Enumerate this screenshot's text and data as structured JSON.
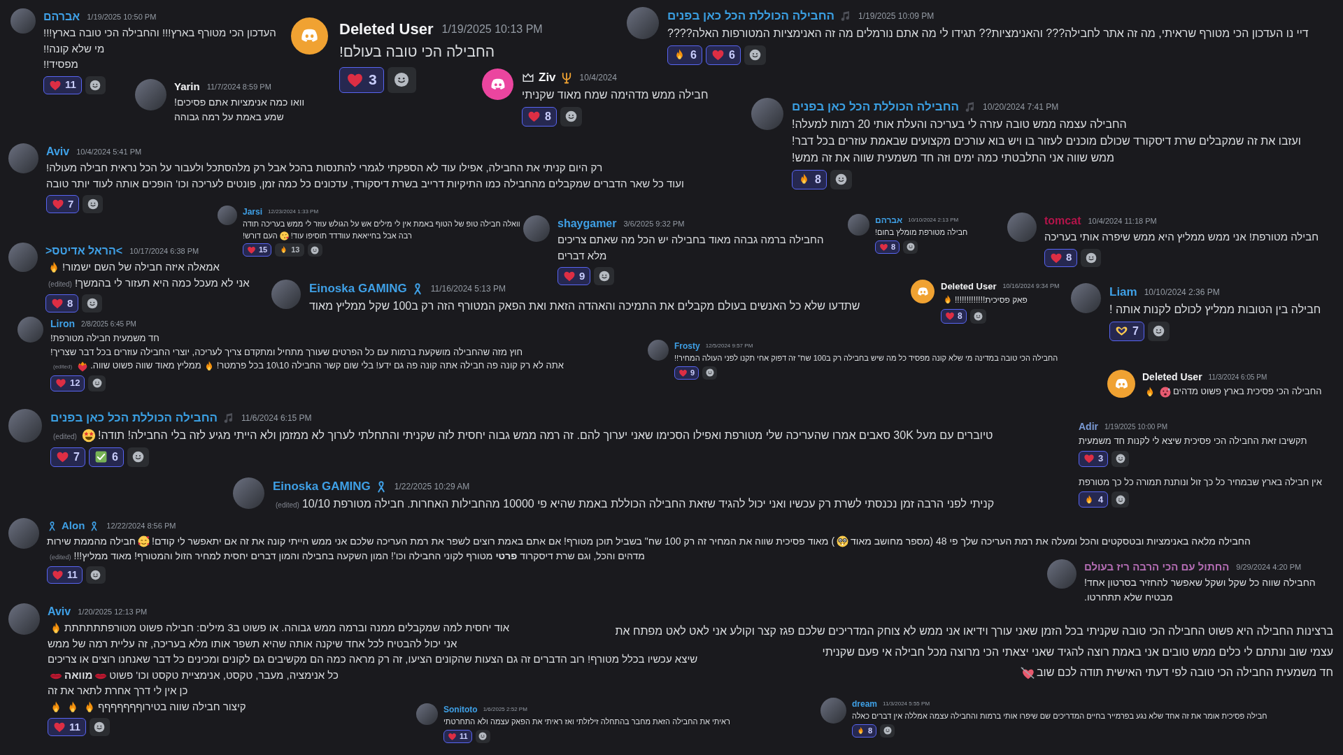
{
  "messages": [
    {
      "name": "החבילה הכוללת הכל כאן בפנים",
      "color": "#3a9ee0",
      "badges_after": [
        {
          "kind": "note"
        }
      ],
      "time": "1/19/2025 10:09 PM",
      "avatar": {
        "kind": "picture"
      },
      "lines": [
        "דיי נו העדכון הכי מטורף שראיתי, מה זה אתר לחבילה??? והאנימציות?? תגידו לי מה אתם נורמלים מה זה האנימציות המטורפות האלה????"
      ],
      "reactions": [
        {
          "kind": "heart",
          "count": "6",
          "selected": true
        },
        {
          "kind": "fire",
          "count": "6",
          "selected": true
        }
      ]
    },
    {
      "name": "Deleted User",
      "color": "#f2f3f5",
      "time": "1/19/2025 10:13 PM",
      "avatar": {
        "kind": "discord",
        "color": "#f0a232"
      },
      "lines": [
        "החבילה הכי טובה בעולם!"
      ],
      "reactions": [
        {
          "kind": "heart",
          "count": "3",
          "selected": true
        }
      ]
    },
    {
      "name": "אברהם",
      "color": "#3fa0e6",
      "time": "1/19/2025 10:50 PM",
      "avatar": {
        "kind": "picture"
      },
      "lines": [
        "העדכון הכי מטורף בארץ!!! והחבילה הכי טובה בארץ!!!",
        "מי שלא קונה!!",
        "מפסיד!!"
      ],
      "reactions": [
        {
          "kind": "heart",
          "count": "11",
          "selected": true
        }
      ]
    },
    {
      "name": "החבילה הכוללת הכל כאן בפנים",
      "color": "#3a9ee0",
      "badges_after": [
        {
          "kind": "note"
        }
      ],
      "time": "10/20/2024 7:41 PM",
      "avatar": {
        "kind": "picture"
      },
      "lines": [
        "החבילה עצמה ממש טובה עזרה לי בעריכה והעלת אותי 20 רמות למעלה!",
        "ועזבו את זה שמקבלים שרת דיסקורד שכולם מוכנים לעזור בו ויש בוא עורכים מקצועים שבאמת עוזרים בכל דבר!",
        "ממש שווה אני התלבטתי כמה ימים וזה חד משמעית שווה את זה ממש!"
      ],
      "reactions": [
        {
          "kind": "fire",
          "count": "8",
          "selected": true
        }
      ]
    },
    {
      "name": "Ziv",
      "color": "#f2f3f5",
      "badges_before": [
        {
          "kind": "crown"
        }
      ],
      "badges_after": [
        {
          "kind": "trident"
        }
      ],
      "time": "10/4/2024",
      "avatar": {
        "kind": "discord",
        "color": "#eb459f"
      },
      "lines": [
        "חבילה ממש מדהימה שמח מאוד שקניתי"
      ],
      "reactions": [
        {
          "kind": "heart",
          "count": "8",
          "selected": true
        }
      ]
    },
    {
      "name": "Yarin",
      "color": "#f2f3f5",
      "time": "11/7/2024 8:59 PM",
      "avatar": {
        "kind": "picture"
      },
      "lines": [
        "וואו כמה אנימציות אתם פסיכים!",
        "שמע באמת על רמה גבוהה"
      ]
    },
    {
      "name": "Aviv",
      "color": "#3fa0e6",
      "time": "10/4/2024 5:41 PM",
      "avatar": {
        "kind": "picture"
      },
      "lines": [
        "רק היום קניתי את החבילה, אפילו עוד לא הספקתי לגמרי להתנסות בהכל אבל רק מלהסתכל ולעבור על הכל נראית חבילה מעולה!",
        "ועוד כל שאר הדברים שמקבלים מהחבילה כמו התיקיות דרייב בשרת דיסקורד, עדכונים כל כמה זמן, פונטים לעריכה וכו' הופכים אותה לעוד יותר טובה"
      ],
      "reactions": [
        {
          "kind": "heart",
          "count": "7",
          "selected": true
        }
      ]
    },
    {
      "name": "tomcat",
      "color": "#b3144a",
      "time": "10/4/2024 11:18 PM",
      "avatar": {
        "kind": "picture"
      },
      "lines": [
        "חבילה מטורפת! אני ממש ממליץ היא ממש שיפרה אותי בעריכה"
      ],
      "reactions": [
        {
          "kind": "heart",
          "count": "8",
          "selected": true
        }
      ]
    },
    {
      "name": "אברהם",
      "color": "#3fa0e6",
      "time": "10/10/2024 2:13 PM",
      "avatar": {
        "kind": "picture"
      },
      "lines": [
        "חבילה מטורפת מומלץ בחום!"
      ],
      "reactions": [
        {
          "kind": "heart",
          "count": "8",
          "selected": true
        }
      ]
    },
    {
      "name": "shaygamer",
      "color": "#3fa0e6",
      "time": "3/6/2025 9:32 PM",
      "avatar": {
        "kind": "picture"
      },
      "lines": [
        "החבילה ברמה גבהה מאוד בחבילה יש הכל מה שאתם צריכים",
        "מלא דברים"
      ],
      "reactions": [
        {
          "kind": "heart",
          "count": "9",
          "selected": true
        }
      ]
    },
    {
      "name": "Jarsi",
      "color": "#3fa0e6",
      "time": "12/23/2024 1:33 PM",
      "avatar": {
        "kind": "picture"
      },
      "lines": [
        "וואלה חבילה טופ של הטוף באמת אין לי מילים אש על הגולש עוזר לי ממש בעריכה תודה",
        [
          {
            "kind": "text",
            "text": "רבה אבל בחייאאת עוודדד תוסיפו עוד!"
          },
          {
            "kind": "kiss-face"
          },
          {
            "kind": "text",
            "text": "העם דורש!"
          }
        ]
      ],
      "reactions": [
        {
          "kind": "fire",
          "count": "13",
          "selected": false
        },
        {
          "kind": "heart",
          "count": "15",
          "selected": true
        }
      ]
    },
    {
      "name": ">הראל אדיטס<",
      "color": "#3fa0e6",
      "time": "10/17/2024 6:38 PM",
      "avatar": {
        "kind": "picture"
      },
      "lines": [
        [
          {
            "kind": "text",
            "text": "אמאלה איזה חבילה של השם ישמור!"
          },
          {
            "kind": "fire"
          }
        ],
        [
          {
            "kind": "text",
            "text": "אני לא מעכל כמה היא תעזור לי בהמשך!"
          },
          {
            "kind": "edited",
            "text": "(edited)"
          }
        ]
      ],
      "reactions": [
        {
          "kind": "heart",
          "count": "8",
          "selected": true
        }
      ]
    },
    {
      "name": "Liam",
      "color": "#3fa0e6",
      "time": "10/10/2024 2:36 PM",
      "avatar": {
        "kind": "picture"
      },
      "lines": [
        "חבילה בין הטובות ממליץ לכולם לקנות אותה !"
      ],
      "reactions": [
        {
          "kind": "heart-hands",
          "count": "7",
          "selected": true
        }
      ]
    },
    {
      "name": "Deleted User",
      "color": "#f2f3f5",
      "time": "10/16/2024 9:34 PM",
      "avatar": {
        "kind": "discord",
        "color": "#f0a232"
      },
      "lines": [
        [
          {
            "kind": "text",
            "text": "פאק פסיכית!!!!!!!!!!!!!"
          },
          {
            "kind": "fire"
          }
        ]
      ],
      "reactions": [
        {
          "kind": "heart",
          "count": "8",
          "selected": true
        }
      ]
    },
    {
      "name": "Einoska GAMING",
      "color": "#3fa0e6",
      "badges_after": [
        {
          "kind": "ribbon"
        }
      ],
      "time": "11/16/2024 5:13 PM",
      "avatar": {
        "kind": "picture"
      },
      "lines": [
        "שתדעו שלא כל האנשים בעולם מקבלים את התמיכה והאהדה הזאת ואת הפאק המטורף הזה רק ב100 שקל ממליץ מאוד"
      ]
    },
    {
      "name": "Deleted User",
      "color": "#f2f3f5",
      "time": "11/3/2024 6:05 PM",
      "avatar": {
        "kind": "discord",
        "color": "#f0a232"
      },
      "lines": [
        [
          {
            "kind": "text",
            "text": "החבילה הכי פסיכית בארץ פשוט מדהים"
          },
          {
            "kind": "hot-face"
          },
          {
            "kind": "fire"
          }
        ]
      ]
    },
    {
      "name": "Frosty",
      "color": "#3fa0e6",
      "time": "12/5/2024 9:57 PM",
      "avatar": {
        "kind": "picture"
      },
      "lines": [
        "החבילה הכי טובה במדינה מי שלא קונה מפסיד כל מה שיש בחבילה רק ב100 שח\" זה דפוק אחי תקנו לפני העולה המחיר!!"
      ],
      "reactions": [
        {
          "kind": "heart",
          "count": "9",
          "selected": true
        }
      ]
    },
    {
      "name": "Liron",
      "color": "#3fa0e6",
      "time": "2/8/2025 6:45 PM",
      "avatar": {
        "kind": "picture"
      },
      "lines": [
        "חד משמעית חבילה מטורפת!",
        "חוץ מזה שהחבילה מושקעת ברמות עם כל הפרטים שעורך מתחיל ומתקדם צריך לעריכה, יוצרי החבילה עוזרים בכל דבר שצריך!",
        [
          {
            "kind": "text",
            "text": "אתה לא רק קונה פה חבילה אתה קונה פה גם ידע! בלי שום קשר החבילה 10\\10 בכל פרמטר!"
          },
          {
            "kind": "fire"
          },
          {
            "kind": "text",
            "text": "ממליץ מאוד שווה פשוט שווה."
          },
          {
            "kind": "heart-fire"
          },
          {
            "kind": "edited",
            "text": "(edited)"
          }
        ]
      ],
      "reactions": [
        {
          "kind": "heart",
          "count": "12",
          "selected": true
        }
      ]
    },
    {
      "name": "Adir",
      "color": "#7b9bd6",
      "time": "1/19/2025 10:00 PM",
      "lines": [
        "תקשיבו זאת החבילה הכי פסיכית שיצא לי לקנות חד משמעית"
      ],
      "reactions": [
        {
          "kind": "heart",
          "count": "3",
          "selected": true
        }
      ],
      "followups": [
        {
          "lines": [
            "אין חבילה בארץ שבמחיר כל כך זול ונותנת תמורה כל כך מטורפת"
          ],
          "reactions": [
            {
              "kind": "fire",
              "count": "4",
              "selected": true
            }
          ]
        }
      ]
    },
    {
      "name": "החבילה הכוללת הכל כאן בפנים",
      "color": "#3a9ee0",
      "badges_after": [
        {
          "kind": "note"
        }
      ],
      "time": "11/6/2024 6:15 PM",
      "avatar": {
        "kind": "picture"
      },
      "lines": [
        [
          {
            "kind": "text",
            "text": "טיוברים עם מעל 30K סאבים אמרו שהעריכה שלי מטורפת ואפילו הסכימו שאני יערוך להם. זה רמה ממש גבוה יחסית לזה שקניתי והתחלתי לערוך לא ממזמן ולא הייתי מגיע לזה בלי החבילה! תודה!"
          },
          {
            "kind": "star-eyes"
          },
          {
            "kind": "edited",
            "text": "(edited)"
          }
        ]
      ],
      "reactions": [
        {
          "kind": "check",
          "count": "6",
          "selected": true
        },
        {
          "kind": "heart",
          "count": "7",
          "selected": true
        }
      ]
    },
    {
      "name": "Einoska GAMING",
      "color": "#3fa0e6",
      "badges_after": [
        {
          "kind": "ribbon"
        }
      ],
      "time": "1/22/2025 10:29 AM",
      "avatar": {
        "kind": "picture"
      },
      "lines": [
        [
          {
            "kind": "text",
            "text": "קניתי לפני הרבה זמן נכנסתי לשרת רק עכשיו ואני יכול להגיד שזאת החבילה הכוללת באמת שהיא פי 10000 מהחבילות האחרות. חבילה מטורפת 10/10"
          },
          {
            "kind": "edited",
            "text": "(edited)"
          }
        ]
      ]
    },
    {
      "name": "החתול עם הכי הרבה ריז בעולם",
      "color": "#b46db4",
      "time": "9/29/2024 4:20 PM",
      "avatar": {
        "kind": "picture"
      },
      "lines": [
        "החבילה שווה כל שקל ושקל שאפשר להחזיר בסרטון אחד!",
        "מבטיח שלא תתחרטו."
      ]
    },
    {
      "name": "Alon",
      "color": "#3fa0e6",
      "badges_before": [
        {
          "kind": "ribbon"
        }
      ],
      "badges_after": [
        {
          "kind": "ribbon"
        }
      ],
      "time": "12/22/2024 8:56 PM",
      "avatar": {
        "kind": "picture"
      },
      "lines": [
        [
          {
            "kind": "text",
            "text": "החבילה מלאה באנימציות ובטסקטים והכל ומעלה את רמת העריכה שלך פי 48 (מספר מחושב מאוד"
          },
          {
            "kind": "nerd"
          },
          {
            "kind": "text",
            "text": ") מאוד פסיכית שווה את המחיר זה רק 100 שח\" בשביל תוכן מטורף! אם אתם באמת רוצים לשפר את רמת העריכה שלכם אני ממש הייתי קונה את זה אם יתאפשר לי קודם!"
          },
          {
            "kind": "smiling-hearts"
          },
          {
            "kind": "text",
            "text": "חבילה מהממת שירות"
          }
        ],
        [
          {
            "kind": "text",
            "text": "מדהים והכל, וגם שרת דיסקרוד **פרטי** מטורף לקוני החבילה וכו'! המון השקעה בחבילה והמון דברים יחסית למחיר הזול והמטורף! מאוד ממליץ!!!"
          },
          {
            "kind": "edited",
            "text": "(edited)"
          }
        ]
      ],
      "reactions": [
        {
          "kind": "heart",
          "count": "11",
          "selected": true
        }
      ]
    },
    {
      "lines": [
        "ברצינות החבילה היא פשוט החבילה הכי טובה שקניתי בכל הזמן שאני עורך וידיאו אני ממש לא צוחק המדריכים שלכם פגז קצר וקולע אני לאט לאט מפתח את",
        "עצמי שוב ונתתם לי כלים ממש טובים אני באמת רוצה להגיד שאני יצאתי הכי מרוצה מכל חבילה אי פעם שקניתי",
        [
          {
            "kind": "text",
            "text": "חד משמעית החבילה הכי טובה לפי דעתי האישית תודה לכם שוב"
          },
          {
            "kind": "heart-arrow"
          }
        ]
      ]
    },
    {
      "name": "dream",
      "color": "#3fa0e6",
      "time": "11/3/2024 5:55 PM",
      "avatar": {
        "kind": "picture"
      },
      "lines": [
        "חבילה פסיכית אומר את זה אחד שלא נגע בפרמייר בחיים המדריכים שם שיפרו אותי ברמות והחבילה עצמה אמללה אין דברים כאלה"
      ],
      "reactions": [
        {
          "kind": "fire",
          "count": "8",
          "selected": true
        }
      ]
    },
    {
      "name": "Sonitoto",
      "color": "#3fa0e6",
      "time": "1/6/2025 2:52 PM",
      "avatar": {
        "kind": "picture"
      },
      "lines": [
        "ראיתי את החבילה הזאת מחבר בהתחלה זילזלתי ואז ראיתי את הפאק עצמה ולא התחרטתי"
      ],
      "reactions": [
        {
          "kind": "heart",
          "count": "11",
          "selected": true
        }
      ]
    },
    {
      "name": "Aviv",
      "color": "#3fa0e6",
      "time": "1/20/2025 12:13 PM",
      "avatar": {
        "kind": "picture"
      },
      "lines": [
        [
          {
            "kind": "text",
            "text": "אוד יחסית למה שמקבלים ממנה וברמה ממש גבוהה. או פשוט ב3 מילים: חבילה פשוט מטורפתתתתתת"
          },
          {
            "kind": "fire"
          }
        ],
        "אני יכול להבטיח לכל אחד שיקנה אותה שהיא תשפר אותו מלא בעריכה, זה עליית רמה של ממש",
        "שיצא עכשיו בכלל מטורף! רוב הדברים זה גם הצעות שהקונים הציעו, זה רק מראה כמה הם מקשיבים גם לקונים ומכינים כל דבר שאנחנו רוצים או צריכים",
        [
          {
            "kind": "text",
            "text": "כל אנימציה, מעבר, טקסט, אנימציית טקסט וכו' פשוט"
          },
          {
            "kind": "lips"
          },
          {
            "kind": "text",
            "text": "**מוואה**"
          },
          {
            "kind": "lips"
          }
        ],
        "כן אין לי דרך אחרת לתאר את זה",
        [
          {
            "kind": "text",
            "text": "קיצור חבילה שווה בטירוףףףףףףף"
          },
          {
            "kind": "fire"
          },
          {
            "kind": "fire"
          },
          {
            "kind": "fire"
          }
        ]
      ],
      "reactions": [
        {
          "kind": "heart",
          "count": "11",
          "selected": true
        }
      ]
    }
  ]
}
